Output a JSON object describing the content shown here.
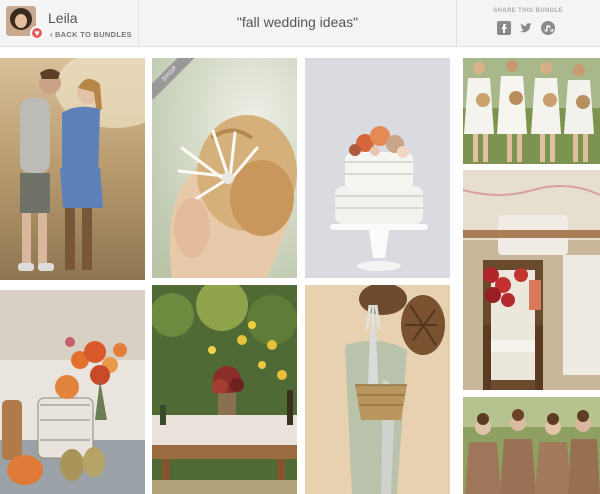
{
  "header": {
    "user_name": "Leila",
    "back_label": "BACK TO BUNDLES",
    "bundle_title": "\"fall wedding ideas\"",
    "share_label": "SHARE THIS BUNDLE"
  },
  "share_icons": [
    "facebook-icon",
    "twitter-icon",
    "stumbleupon-icon"
  ],
  "tiles": {
    "shop_badge": "SHOP"
  },
  "colors": {
    "header_bg": "#f4f4f4",
    "badge": "#e45a5a",
    "icon_gray": "#888888"
  }
}
